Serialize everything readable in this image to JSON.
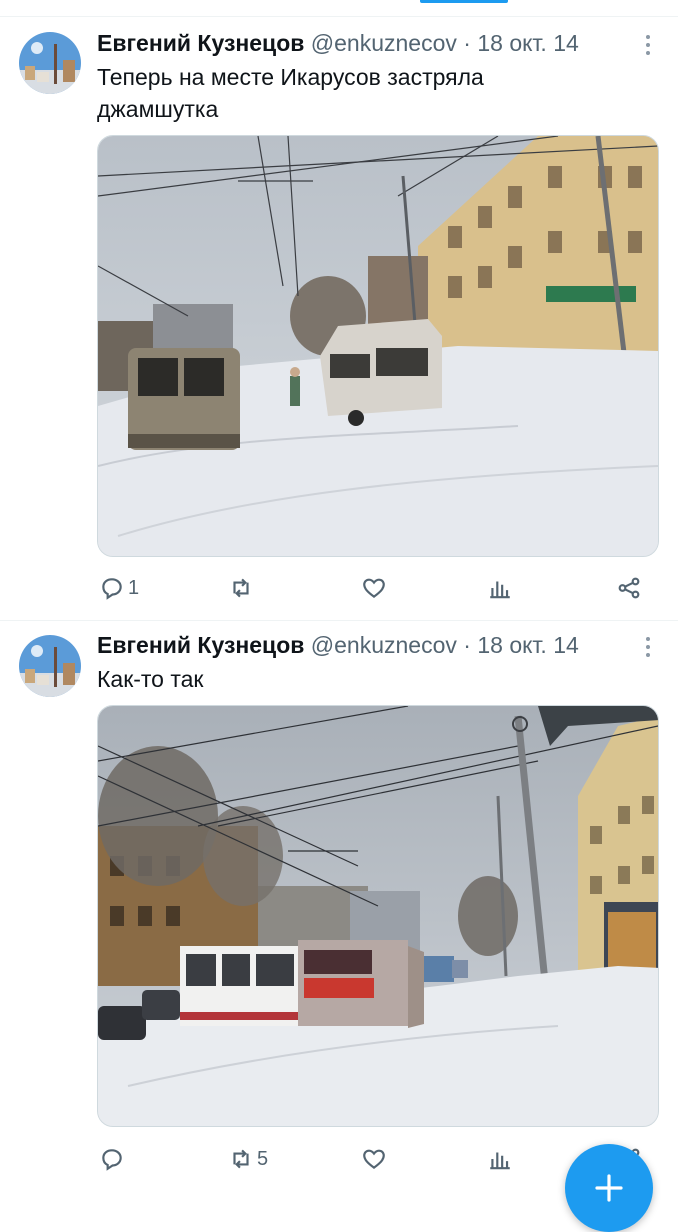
{
  "tweets": [
    {
      "author_name": "Евгений Кузнецов",
      "handle": "@enkuznecov",
      "separator": "·",
      "date": "18 окт. 14",
      "text_line1": "Теперь на месте Икарусов застряла",
      "text_line2": "джамшутка",
      "media_description_icon": "photo-snowy-street-minibuses",
      "reply_count": "1",
      "retweet_count": "",
      "like_count": ""
    },
    {
      "author_name": "Евгений Кузнецов",
      "handle": "@enkuznecov",
      "separator": "·",
      "date": "18 окт. 14",
      "text_line1": "Как-то так",
      "media_description_icon": "photo-snowy-street-trolleybuses",
      "reply_count": "",
      "retweet_count": "5",
      "like_count": ""
    }
  ],
  "icons": {
    "reply": "reply-icon",
    "retweet": "retweet-icon",
    "like": "heart-icon",
    "analytics": "analytics-icon",
    "share": "share-icon",
    "more": "more-icon",
    "compose": "compose-plus-icon"
  },
  "colors": {
    "accent": "#1d9bf0",
    "secondary_text": "#536471",
    "primary_text": "#0f1419"
  }
}
